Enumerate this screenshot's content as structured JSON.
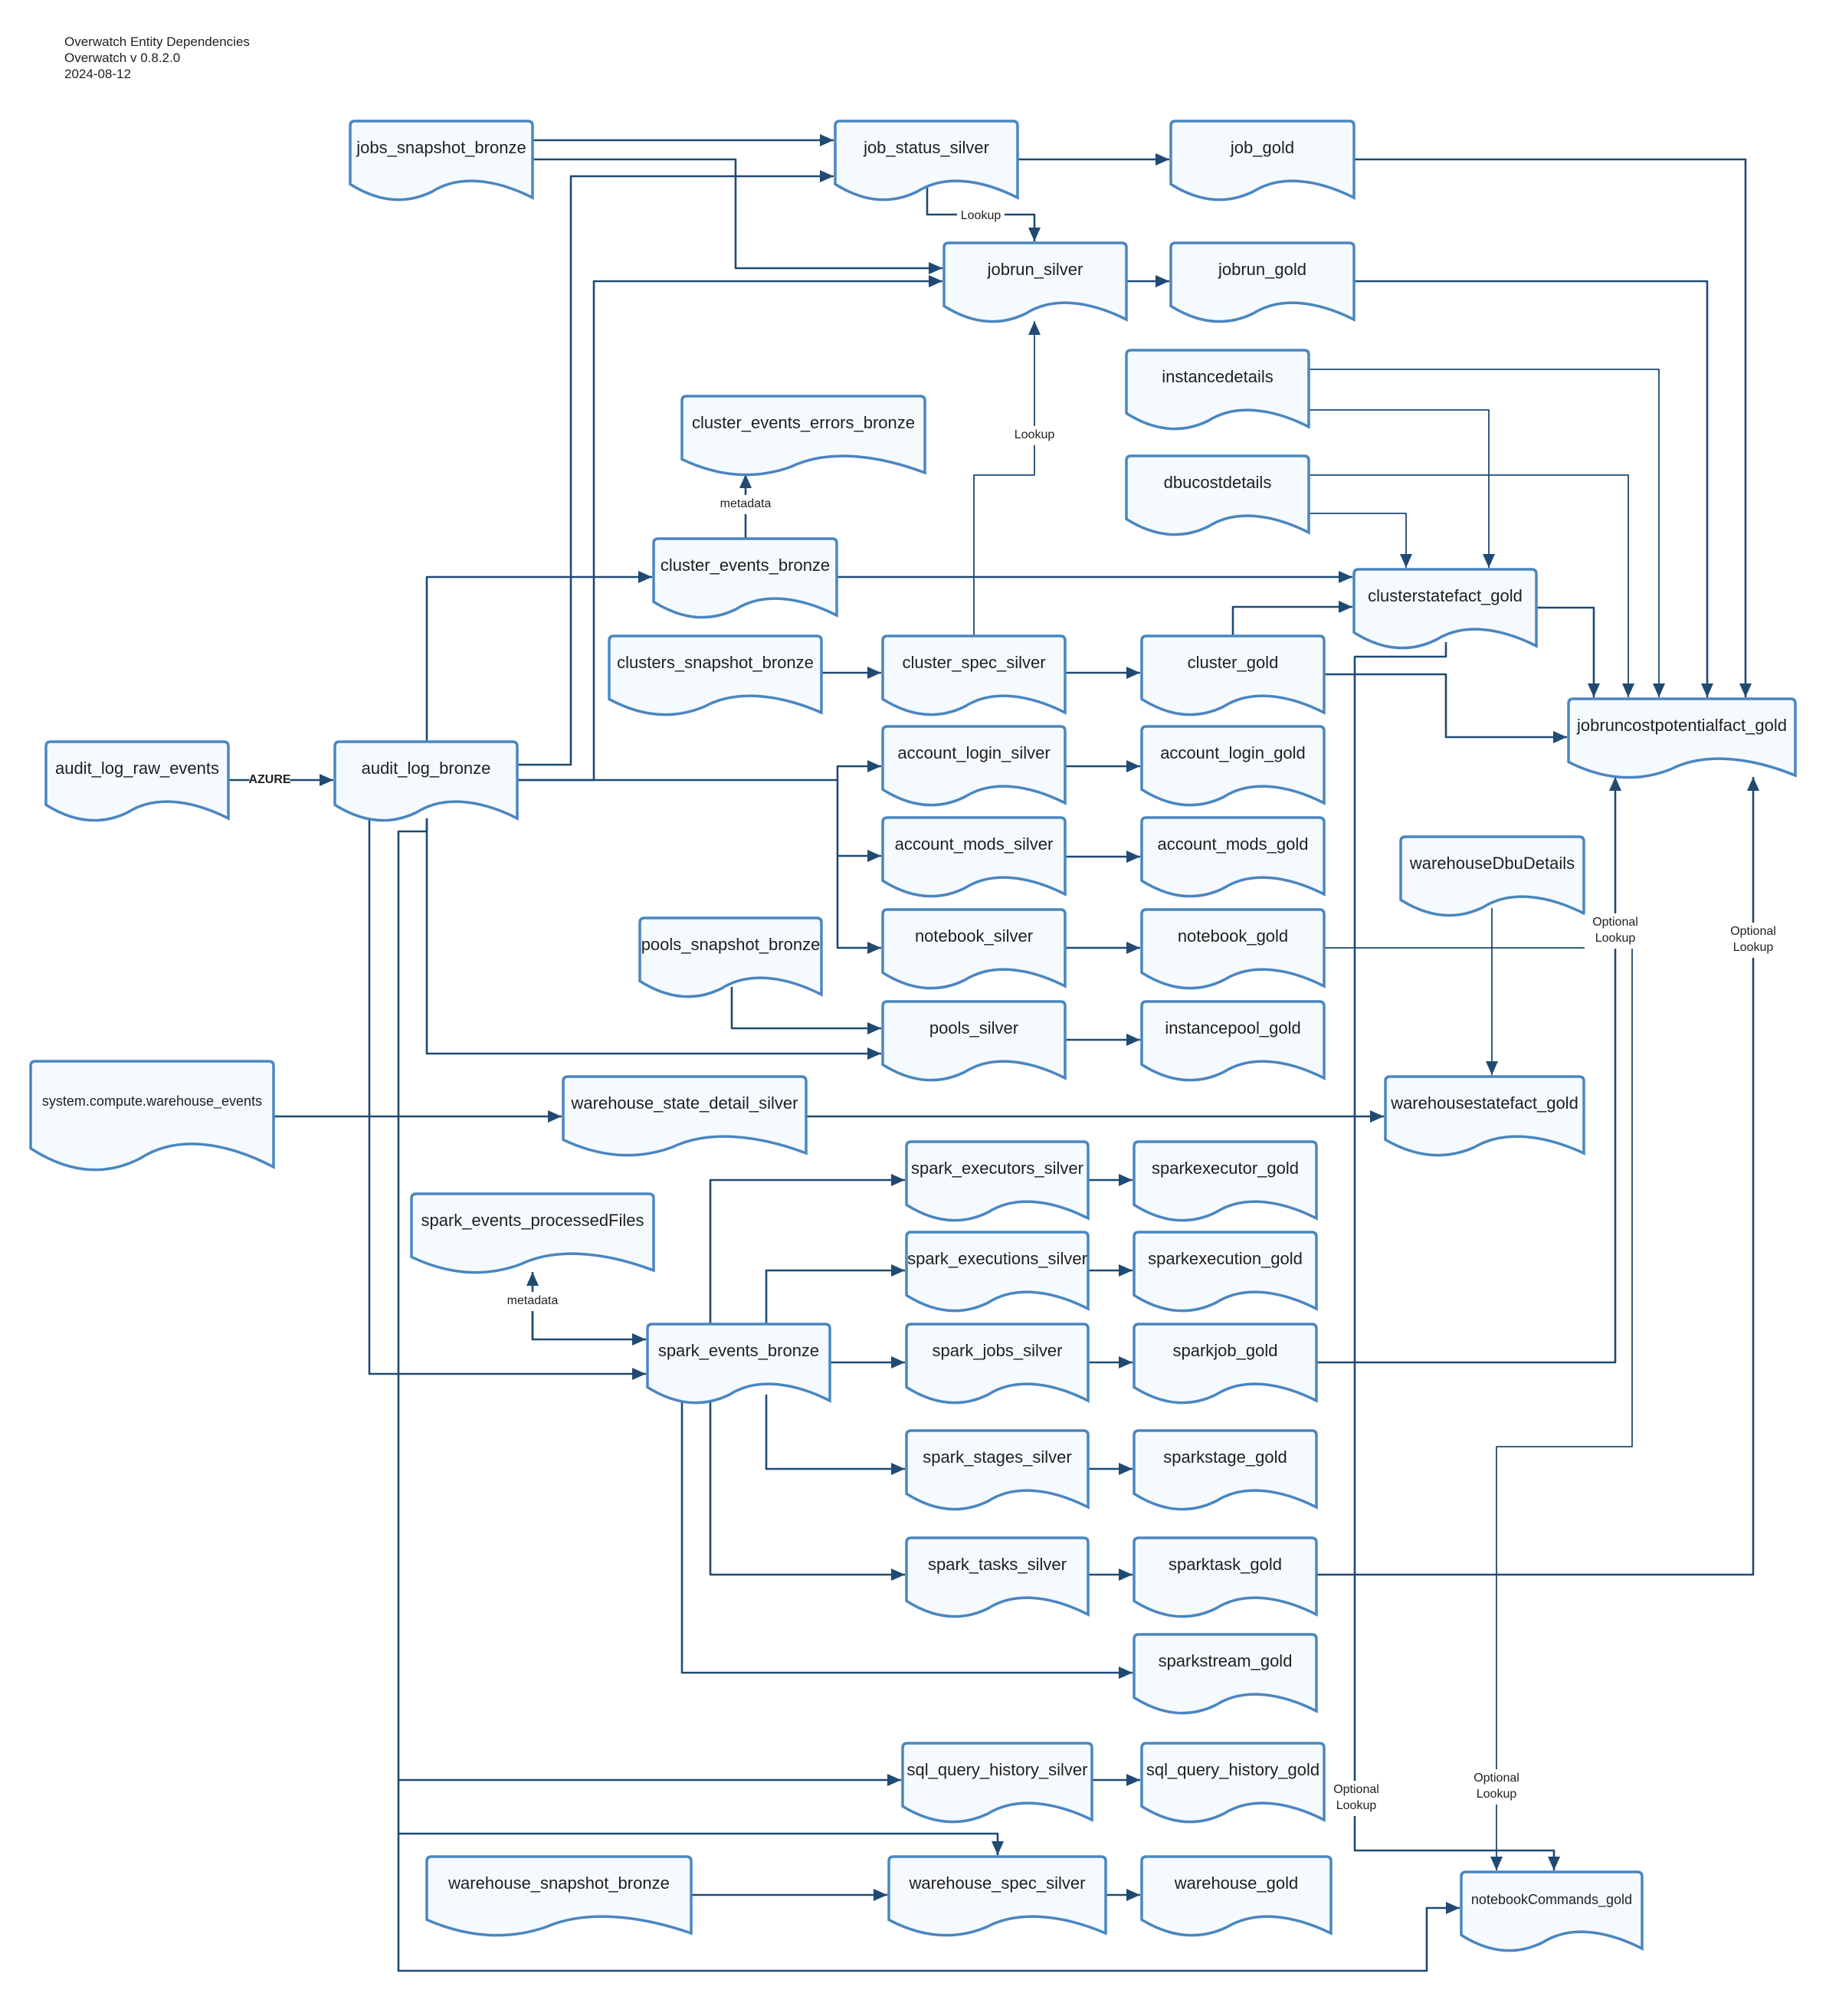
{
  "header": {
    "title": "Overwatch Entity Dependencies",
    "version": "Overwatch v 0.8.2.0",
    "date": "2024-08-12"
  },
  "colors": {
    "node_fill": "#f5faff",
    "node_stroke": "#4a86c0",
    "edge": "#1f4a73",
    "text": "#1f1f1f"
  },
  "nodes": {
    "jobs_snapshot_bronze": "jobs_snapshot_bronze",
    "job_status_silver": "job_status_silver",
    "job_gold": "job_gold",
    "jobrun_silver": "jobrun_silver",
    "jobrun_gold": "jobrun_gold",
    "instancedetails": "instancedetails",
    "cluster_events_errors_bronze": "cluster_events_errors_bronze",
    "dbucostdetails": "dbucostdetails",
    "cluster_events_bronze": "cluster_events_bronze",
    "clusterstatefact_gold": "clusterstatefact_gold",
    "clusters_snapshot_bronze": "clusters_snapshot_bronze",
    "cluster_spec_silver": "cluster_spec_silver",
    "cluster_gold": "cluster_gold",
    "jobruncostpotentialfact_gold": "jobruncostpotentialfact_gold",
    "audit_log_raw_events": "audit_log_raw_events",
    "audit_log_bronze": "audit_log_bronze",
    "account_login_silver": "account_login_silver",
    "account_login_gold": "account_login_gold",
    "account_mods_silver": "account_mods_silver",
    "account_mods_gold": "account_mods_gold",
    "warehouseDbuDetails": "warehouseDbuDetails",
    "pools_snapshot_bronze": "pools_snapshot_bronze",
    "notebook_silver": "notebook_silver",
    "notebook_gold": "notebook_gold",
    "pools_silver": "pools_silver",
    "instancepool_gold": "instancepool_gold",
    "system_compute_warehouse_events": "system.compute.warehouse_events",
    "warehouse_state_detail_silver": "warehouse_state_detail_silver",
    "warehousestatefact_gold": "warehousestatefact_gold",
    "spark_executors_silver": "spark_executors_silver",
    "sparkexecutor_gold": "sparkexecutor_gold",
    "spark_events_processedFiles": "spark_events_processedFiles",
    "spark_executions_silver": "spark_executions_silver",
    "sparkexecution_gold": "sparkexecution_gold",
    "spark_events_bronze": "spark_events_bronze",
    "spark_jobs_silver": "spark_jobs_silver",
    "sparkjob_gold": "sparkjob_gold",
    "spark_stages_silver": "spark_stages_silver",
    "sparkstage_gold": "sparkstage_gold",
    "spark_tasks_silver": "spark_tasks_silver",
    "sparktask_gold": "sparktask_gold",
    "sparkstream_gold": "sparkstream_gold",
    "sql_query_history_silver": "sql_query_history_silver",
    "sql_query_history_gold": "sql_query_history_gold",
    "warehouse_snapshot_bronze": "warehouse_snapshot_bronze",
    "warehouse_spec_silver": "warehouse_spec_silver",
    "warehouse_gold": "warehouse_gold",
    "notebookCommands_gold": "notebookCommands_gold"
  },
  "edge_labels": {
    "azure": "AZURE",
    "lookup_job_status": "Lookup",
    "lookup_cluster_spec": "Lookup",
    "metadata_cluster_events": "metadata",
    "metadata_spark_events": "metadata",
    "optional_lookup_line1": "Optional",
    "optional_lookup_line2": "Lookup"
  },
  "edges": [
    {
      "from": "jobs_snapshot_bronze",
      "to": "job_status_silver"
    },
    {
      "from": "jobs_snapshot_bronze",
      "to": "jobrun_silver"
    },
    {
      "from": "audit_log_bronze",
      "to": "job_status_silver"
    },
    {
      "from": "audit_log_bronze",
      "to": "jobrun_silver"
    },
    {
      "from": "job_status_silver",
      "to": "job_gold"
    },
    {
      "from": "job_status_silver",
      "to": "jobrun_silver",
      "label": "Lookup"
    },
    {
      "from": "jobrun_silver",
      "to": "jobrun_gold"
    },
    {
      "from": "cluster_spec_silver",
      "to": "jobrun_silver",
      "label": "Lookup"
    },
    {
      "from": "cluster_events_bronze",
      "to": "cluster_events_errors_bronze",
      "label": "metadata"
    },
    {
      "from": "audit_log_bronze",
      "to": "cluster_events_bronze"
    },
    {
      "from": "cluster_events_bronze",
      "to": "clusterstatefact_gold"
    },
    {
      "from": "cluster_gold",
      "to": "clusterstatefact_gold"
    },
    {
      "from": "instancedetails",
      "to": "clusterstatefact_gold"
    },
    {
      "from": "dbucostdetails",
      "to": "clusterstatefact_gold"
    },
    {
      "from": "clusters_snapshot_bronze",
      "to": "cluster_spec_silver"
    },
    {
      "from": "cluster_spec_silver",
      "to": "cluster_gold"
    },
    {
      "from": "job_gold",
      "to": "jobruncostpotentialfact_gold"
    },
    {
      "from": "jobrun_gold",
      "to": "jobruncostpotentialfact_gold"
    },
    {
      "from": "instancedetails",
      "to": "jobruncostpotentialfact_gold"
    },
    {
      "from": "dbucostdetails",
      "to": "jobruncostpotentialfact_gold"
    },
    {
      "from": "clusterstatefact_gold",
      "to": "jobruncostpotentialfact_gold"
    },
    {
      "from": "cluster_gold",
      "to": "jobruncostpotentialfact_gold"
    },
    {
      "from": "sparkjob_gold",
      "to": "jobruncostpotentialfact_gold",
      "label": "Optional Lookup"
    },
    {
      "from": "sparktask_gold",
      "to": "jobruncostpotentialfact_gold",
      "label": "Optional Lookup"
    },
    {
      "from": "audit_log_raw_events",
      "to": "audit_log_bronze",
      "label": "AZURE"
    },
    {
      "from": "audit_log_bronze",
      "to": "account_login_silver"
    },
    {
      "from": "audit_log_bronze",
      "to": "account_mods_silver"
    },
    {
      "from": "audit_log_bronze",
      "to": "notebook_silver"
    },
    {
      "from": "account_login_silver",
      "to": "account_login_gold"
    },
    {
      "from": "account_mods_silver",
      "to": "account_mods_gold"
    },
    {
      "from": "notebook_silver",
      "to": "notebook_gold"
    },
    {
      "from": "pools_snapshot_bronze",
      "to": "pools_silver"
    },
    {
      "from": "audit_log_bronze",
      "to": "pools_silver"
    },
    {
      "from": "pools_silver",
      "to": "instancepool_gold"
    },
    {
      "from": "warehouseDbuDetails",
      "to": "warehousestatefact_gold"
    },
    {
      "from": "system_compute_warehouse_events",
      "to": "warehouse_state_detail_silver"
    },
    {
      "from": "warehouse_state_detail_silver",
      "to": "warehousestatefact_gold"
    },
    {
      "from": "spark_events_bronze",
      "to": "spark_events_processedFiles",
      "label": "metadata"
    },
    {
      "from": "audit_log_bronze",
      "to": "spark_events_bronze"
    },
    {
      "from": "spark_events_bronze",
      "to": "spark_executors_silver"
    },
    {
      "from": "spark_events_bronze",
      "to": "spark_executions_silver"
    },
    {
      "from": "spark_events_bronze",
      "to": "spark_jobs_silver"
    },
    {
      "from": "spark_events_bronze",
      "to": "spark_stages_silver"
    },
    {
      "from": "spark_events_bronze",
      "to": "spark_tasks_silver"
    },
    {
      "from": "spark_events_bronze",
      "to": "sparkstream_gold"
    },
    {
      "from": "spark_executors_silver",
      "to": "sparkexecutor_gold"
    },
    {
      "from": "spark_executions_silver",
      "to": "sparkexecution_gold"
    },
    {
      "from": "spark_jobs_silver",
      "to": "sparkjob_gold"
    },
    {
      "from": "spark_stages_silver",
      "to": "sparkstage_gold"
    },
    {
      "from": "spark_tasks_silver",
      "to": "sparktask_gold"
    },
    {
      "from": "audit_log_bronze",
      "to": "sql_query_history_silver"
    },
    {
      "from": "sql_query_history_silver",
      "to": "sql_query_history_gold"
    },
    {
      "from": "audit_log_bronze",
      "to": "warehouse_spec_silver"
    },
    {
      "from": "warehouse_snapshot_bronze",
      "to": "warehouse_spec_silver"
    },
    {
      "from": "warehouse_spec_silver",
      "to": "warehouse_gold"
    },
    {
      "from": "audit_log_bronze",
      "to": "notebookCommands_gold"
    },
    {
      "from": "notebook_gold",
      "to": "notebookCommands_gold",
      "label": "Optional Lookup"
    },
    {
      "from": "clusterstatefact_gold",
      "to": "notebookCommands_gold",
      "label": "Optional Lookup"
    }
  ]
}
